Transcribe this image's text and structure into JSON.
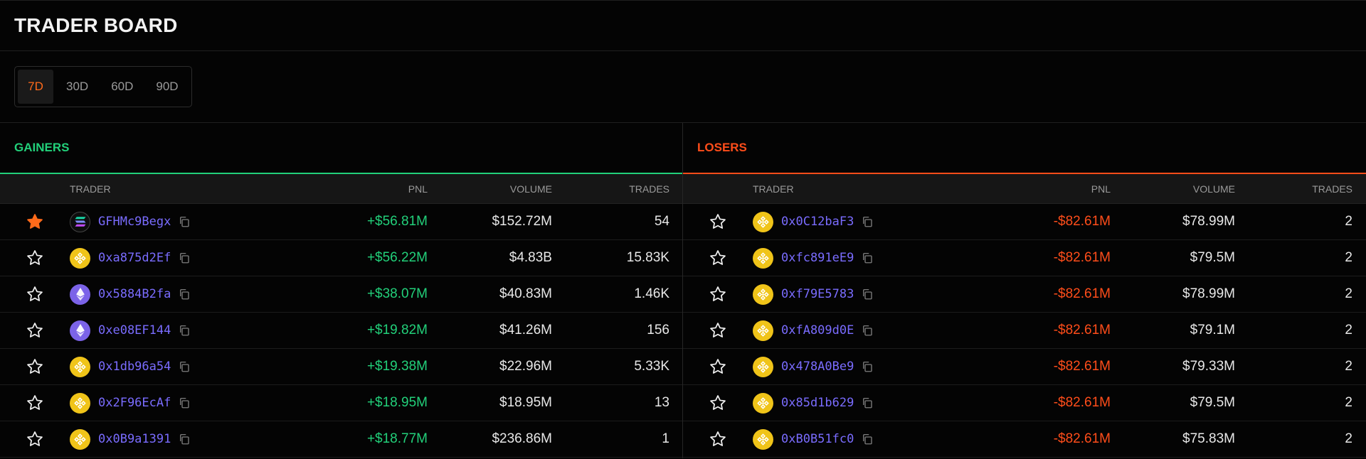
{
  "title": "TRADER BOARD",
  "periods": [
    "7D",
    "30D",
    "60D",
    "90D"
  ],
  "active_period": "7D",
  "colors": {
    "gain": "#22d07a",
    "loss": "#ff4d1a",
    "accent": "#ff6a1a",
    "address": "#7a6cff"
  },
  "columns": {
    "trader": "TRADER",
    "pnl": "PNL",
    "volume": "VOLUME",
    "trades": "TRADES"
  },
  "gainers": {
    "title": "GAINERS",
    "rows": [
      {
        "starred": true,
        "coin": "sol-icon",
        "address": "GFHMc9Begx",
        "pnl": "+$56.81M",
        "volume": "$152.72M",
        "trades": "54"
      },
      {
        "starred": false,
        "coin": "bnb-icon",
        "address": "0xa875d2Ef",
        "pnl": "+$56.22M",
        "volume": "$4.83B",
        "trades": "15.83K"
      },
      {
        "starred": false,
        "coin": "eth-icon",
        "address": "0x5884B2fa",
        "pnl": "+$38.07M",
        "volume": "$40.83M",
        "trades": "1.46K"
      },
      {
        "starred": false,
        "coin": "eth-icon",
        "address": "0xe08EF144",
        "pnl": "+$19.82M",
        "volume": "$41.26M",
        "trades": "156"
      },
      {
        "starred": false,
        "coin": "bnb-icon",
        "address": "0x1db96a54",
        "pnl": "+$19.38M",
        "volume": "$22.96M",
        "trades": "5.33K"
      },
      {
        "starred": false,
        "coin": "bnb-icon",
        "address": "0x2F96EcAf",
        "pnl": "+$18.95M",
        "volume": "$18.95M",
        "trades": "13"
      },
      {
        "starred": false,
        "coin": "bnb-icon",
        "address": "0x0B9a1391",
        "pnl": "+$18.77M",
        "volume": "$236.86M",
        "trades": "1"
      }
    ]
  },
  "losers": {
    "title": "LOSERS",
    "rows": [
      {
        "starred": false,
        "coin": "bnb-icon",
        "address": "0x0C12baF3",
        "pnl": "-$82.61M",
        "volume": "$78.99M",
        "trades": "2"
      },
      {
        "starred": false,
        "coin": "bnb-icon",
        "address": "0xfc891eE9",
        "pnl": "-$82.61M",
        "volume": "$79.5M",
        "trades": "2"
      },
      {
        "starred": false,
        "coin": "bnb-icon",
        "address": "0xf79E5783",
        "pnl": "-$82.61M",
        "volume": "$78.99M",
        "trades": "2"
      },
      {
        "starred": false,
        "coin": "bnb-icon",
        "address": "0xfA809d0E",
        "pnl": "-$82.61M",
        "volume": "$79.1M",
        "trades": "2"
      },
      {
        "starred": false,
        "coin": "bnb-icon",
        "address": "0x478A0Be9",
        "pnl": "-$82.61M",
        "volume": "$79.33M",
        "trades": "2"
      },
      {
        "starred": false,
        "coin": "bnb-icon",
        "address": "0x85d1b629",
        "pnl": "-$82.61M",
        "volume": "$79.5M",
        "trades": "2"
      },
      {
        "starred": false,
        "coin": "bnb-icon",
        "address": "0xB0B51fc0",
        "pnl": "-$82.61M",
        "volume": "$75.83M",
        "trades": "2"
      }
    ]
  }
}
